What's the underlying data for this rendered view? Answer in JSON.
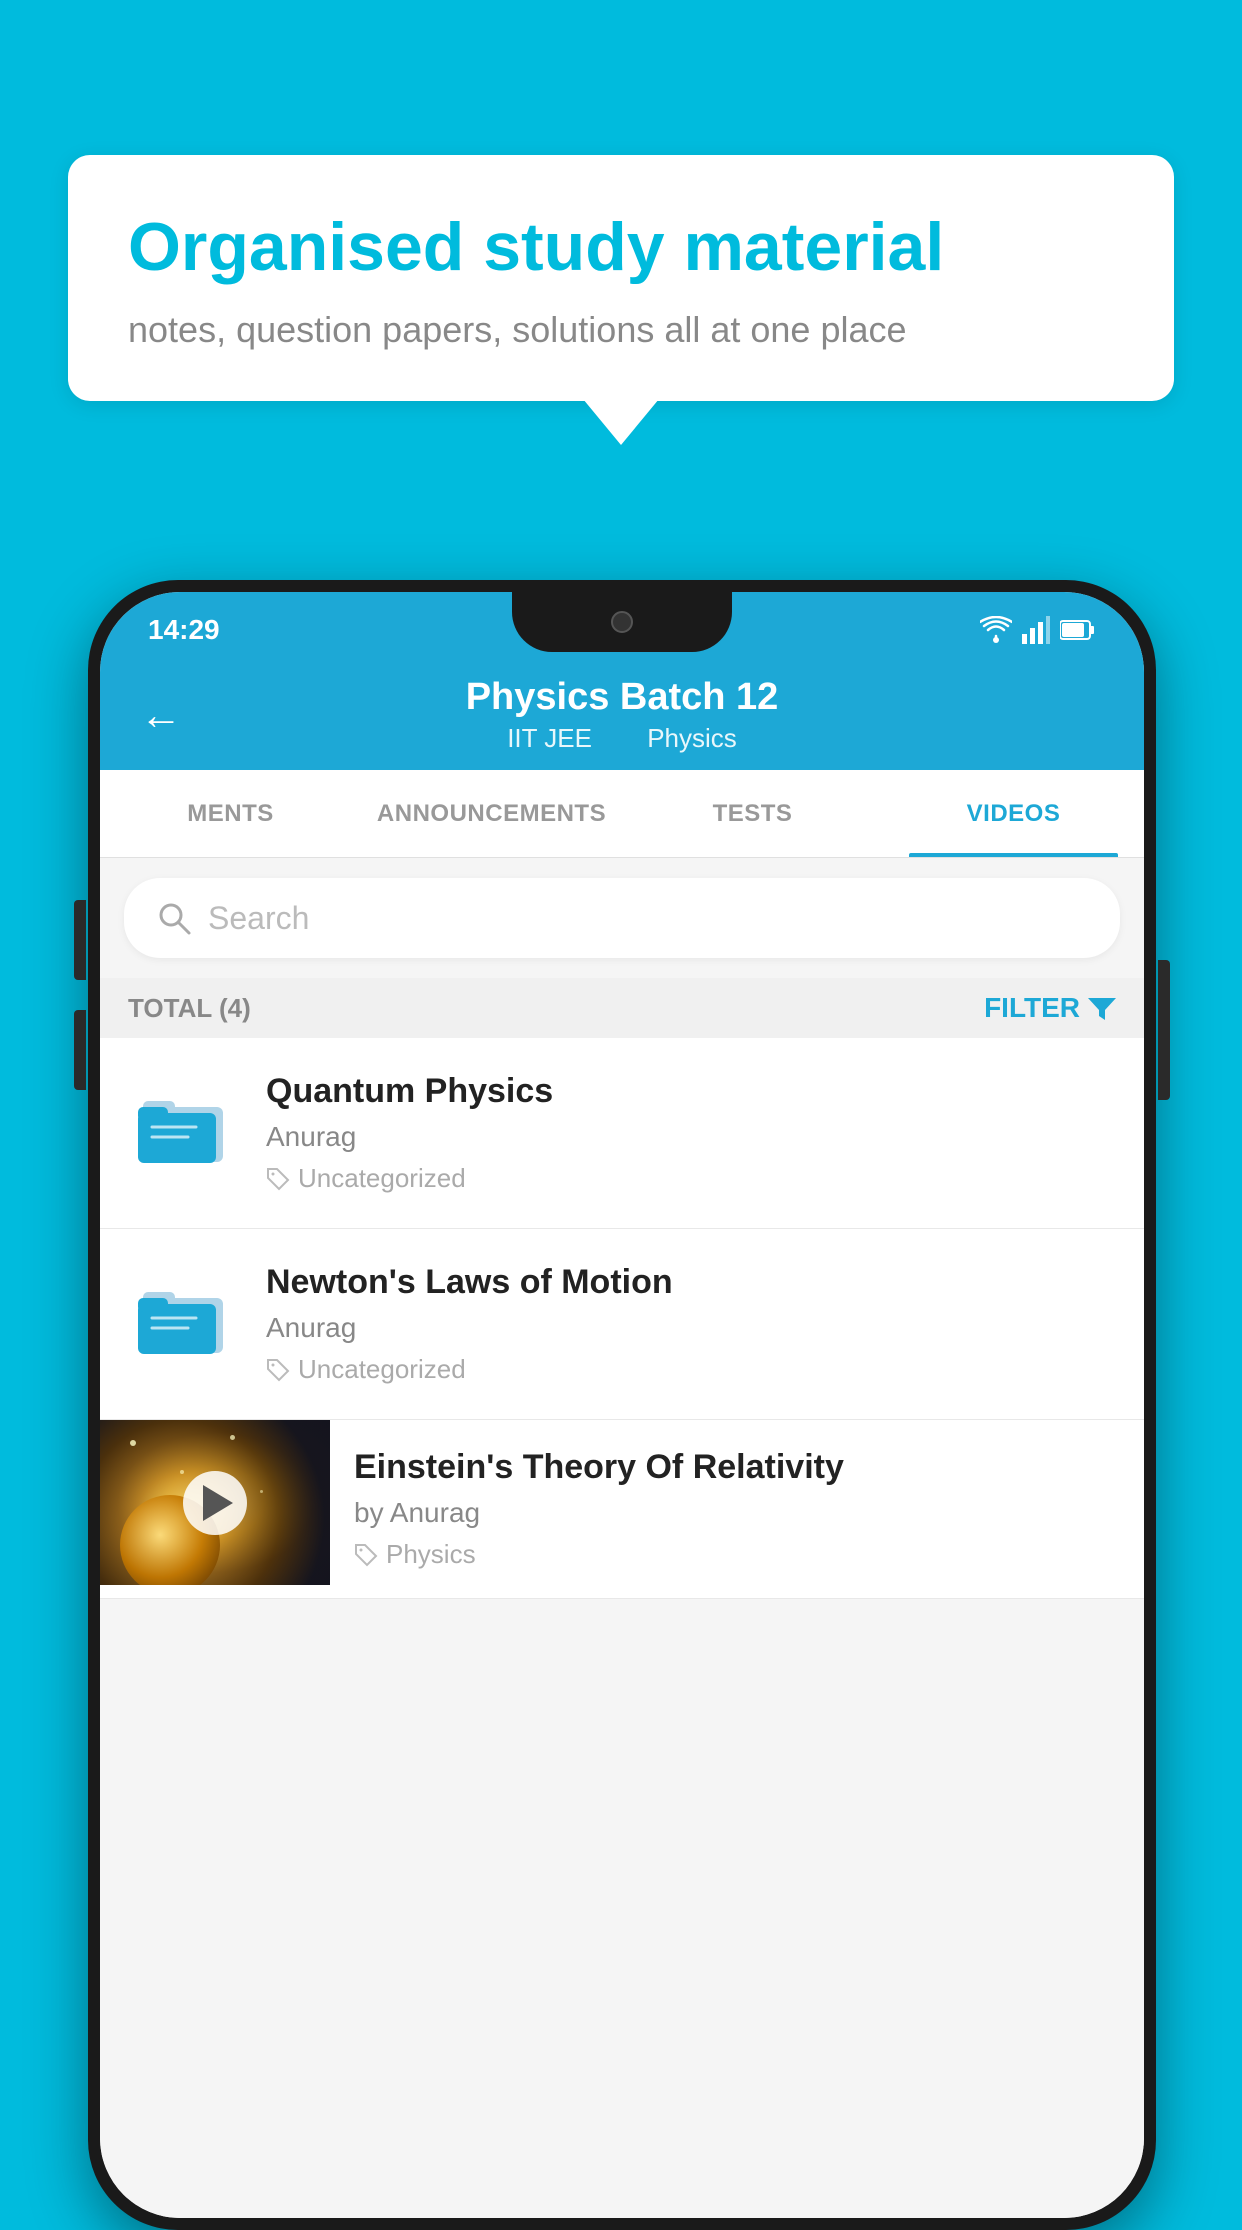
{
  "background_color": "#00BBDD",
  "bubble": {
    "title": "Organised study material",
    "subtitle": "notes, question papers, solutions all at one place"
  },
  "status_bar": {
    "time": "14:29",
    "wifi": "▼",
    "signal": "▲",
    "battery": "▮"
  },
  "header": {
    "title": "Physics Batch 12",
    "subtitle_left": "IIT JEE",
    "subtitle_right": "Physics",
    "back_label": "←"
  },
  "tabs": [
    {
      "label": "MENTS",
      "active": false
    },
    {
      "label": "ANNOUNCEMENTS",
      "active": false
    },
    {
      "label": "TESTS",
      "active": false
    },
    {
      "label": "VIDEOS",
      "active": true
    }
  ],
  "search": {
    "placeholder": "Search"
  },
  "filter": {
    "total_label": "TOTAL (4)",
    "filter_label": "FILTER"
  },
  "videos": [
    {
      "title": "Quantum Physics",
      "author": "Anurag",
      "tag": "Uncategorized",
      "has_thumb": false
    },
    {
      "title": "Newton's Laws of Motion",
      "author": "Anurag",
      "tag": "Uncategorized",
      "has_thumb": false
    },
    {
      "title": "Einstein's Theory Of Relativity",
      "author": "by Anurag",
      "tag": "Physics",
      "has_thumb": true
    }
  ]
}
